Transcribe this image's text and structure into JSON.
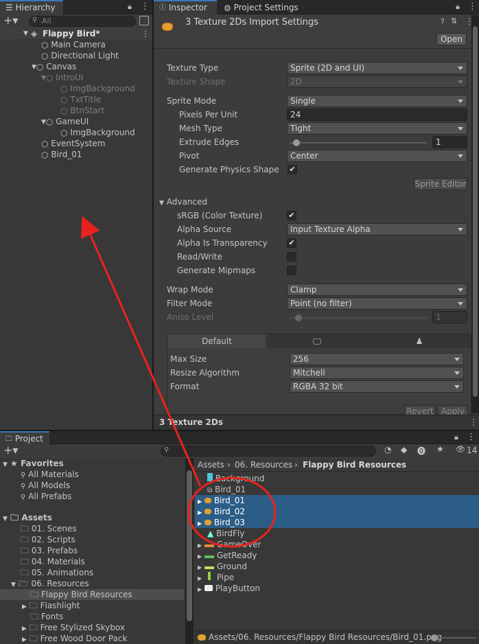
{
  "hierarchy": {
    "tab": "Hierarchy",
    "search_placeholder": "All",
    "scene": "Flappy Bird*",
    "items": [
      "Main Camera",
      "Directional Light",
      "Canvas",
      "IntroUI",
      "ImgBackground",
      "TxtTitle",
      "BtnStart",
      "GameUI",
      "ImgBackground",
      "EventSystem",
      "Bird_01"
    ]
  },
  "inspector": {
    "tab": "Inspector",
    "tab2": "Project Settings",
    "title": "3 Texture 2Ds Import Settings",
    "open": "Open",
    "texture_type_label": "Texture Type",
    "texture_type": "Sprite (2D and UI)",
    "texture_shape_label": "Texture Shape",
    "texture_shape": "2D",
    "sprite_mode_label": "Sprite Mode",
    "sprite_mode": "Single",
    "ppu_label": "Pixels Per Unit",
    "ppu": "24",
    "mesh_type_label": "Mesh Type",
    "mesh_type": "Tight",
    "extrude_label": "Extrude Edges",
    "extrude": "1",
    "pivot_label": "Pivot",
    "pivot": "Center",
    "physics_label": "Generate Physics Shape",
    "sprite_editor": "Sprite Editor",
    "advanced": "Advanced",
    "srgb_label": "sRGB (Color Texture)",
    "alpha_source_label": "Alpha Source",
    "alpha_source": "Input Texture Alpha",
    "alpha_transp_label": "Alpha Is Transparency",
    "readwrite_label": "Read/Write",
    "mipmaps_label": "Generate Mipmaps",
    "wrap_label": "Wrap Mode",
    "wrap": "Clamp",
    "filter_label": "Filter Mode",
    "filter": "Point (no filter)",
    "aniso_label": "Aniso Level",
    "aniso": "1",
    "platform_default": "Default",
    "maxsize_label": "Max Size",
    "maxsize": "256",
    "resize_label": "Resize Algorithm",
    "resize": "Mitchell",
    "format_label": "Format",
    "format": "RGBA 32 bit",
    "revert": "Revert",
    "apply": "Apply",
    "footer": "3 Texture 2Ds"
  },
  "project": {
    "tab": "Project",
    "count": "14",
    "favorites": "Favorites",
    "fav_items": [
      "All Materials",
      "All Models",
      "All Prefabs"
    ],
    "assets": "Assets",
    "folders": [
      "01. Scenes",
      "02. Scripts",
      "03. Prefabs",
      "04. Materials",
      "05. Animations",
      "06. Resources"
    ],
    "subfolders": [
      "Flappy Bird Resources",
      "Flashlight",
      "Fonts",
      "Free Stylized Skybox",
      "Free Wood Door Pack"
    ],
    "breadcrumb": [
      "Assets",
      "06. Resources",
      "Flappy Bird Resources"
    ],
    "files": [
      "Background",
      "Bird_01",
      "Bird_01",
      "Bird_02",
      "Bird_03",
      "BirdFly",
      "GameOver",
      "GetReady",
      "Ground",
      "Pipe",
      "PlayButton"
    ],
    "status_path": "Assets/06. Resources/Flappy Bird Resources/Bird_01.png"
  },
  "colors": {
    "annotation": "#e8231d",
    "selection": "#2c5d87",
    "accent": "#3a79bb"
  }
}
